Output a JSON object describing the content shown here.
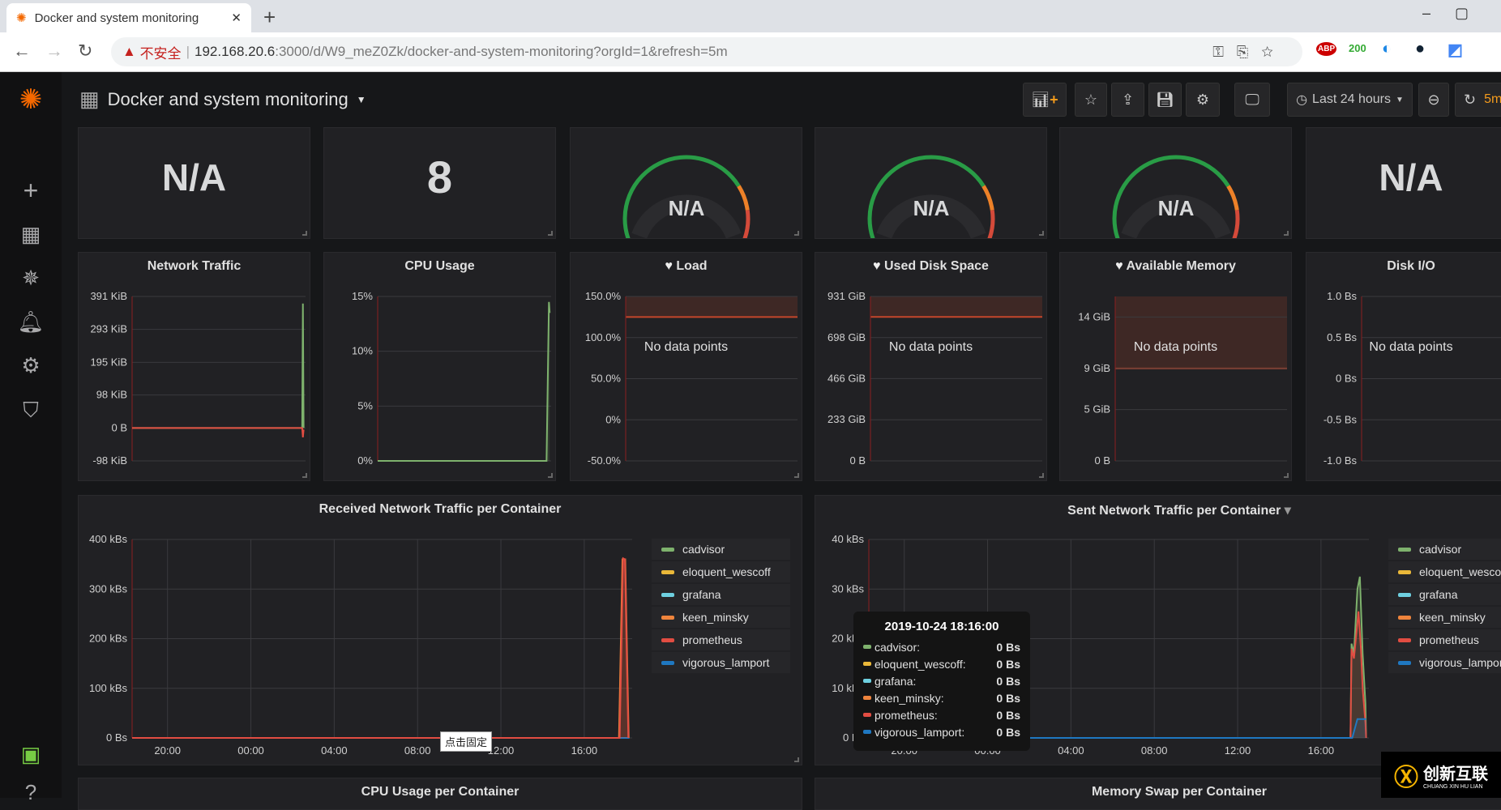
{
  "browser": {
    "tab_title": "Docker and system monitoring",
    "new_tab": "+",
    "insecure": "不安全",
    "url_host": "192.168.20.6",
    "url_rest": ":3000/d/W9_meZ0Zk/docker-and-system-monitoring?orgId=1&refresh=5m",
    "ext_abp": "ABP",
    "ext_count": "200"
  },
  "header": {
    "title": "Docker and system monitoring",
    "time_range": "Last 24 hours",
    "refresh": "5m"
  },
  "time_axis": {
    "start": "2019-10-23T18:18:00",
    "end": "2019-10-24T18:18:00",
    "ticks": [
      "20:00",
      "00:00",
      "04:00",
      "08:00",
      "12:00",
      "16:00"
    ]
  },
  "stats": [
    {
      "value": "N/A",
      "type": "singlestat"
    },
    {
      "value": "8",
      "type": "singlestat"
    },
    {
      "value": "N/A",
      "type": "gauge"
    },
    {
      "value": "N/A",
      "type": "gauge"
    },
    {
      "value": "N/A",
      "type": "gauge"
    },
    {
      "value": "N/A",
      "type": "singlestat"
    }
  ],
  "colors": {
    "cadvisor": "#7eb26d",
    "eloquent_wescoff": "#eab839",
    "grafana": "#6ed0e0",
    "keen_minsky": "#ef843c",
    "prometheus": "#e24d42",
    "vigorous_lamport": "#1f78c1",
    "threshold": "#c4462b",
    "gauge_green": "#299c46",
    "gauge_orange": "#ed8128",
    "gauge_red": "#d44a3a"
  },
  "small_graphs": [
    {
      "title": "Network Traffic",
      "heart": false,
      "nodata": "",
      "yticks": [
        [
          "391 KiB",
          391
        ],
        [
          "293 KiB",
          293
        ],
        [
          "195 KiB",
          195
        ],
        [
          "98 KiB",
          98
        ],
        [
          "0 B",
          0
        ],
        [
          "-98 KiB",
          -98
        ]
      ],
      "ymin": -98,
      "ymax": 391,
      "series": [
        {
          "color": "#7eb26d",
          "points": [
            [
              "2019-10-23T18:18",
              0
            ],
            [
              "2019-10-24T17:50",
              0
            ],
            [
              "2019-10-24T17:56",
              370
            ],
            [
              "2019-10-24T18:02",
              0
            ]
          ]
        },
        {
          "color": "#e24d42",
          "points": [
            [
              "2019-10-23T18:18",
              0
            ],
            [
              "2019-10-24T17:50",
              0
            ],
            [
              "2019-10-24T17:56",
              -28
            ],
            [
              "2019-10-24T18:02",
              -5
            ]
          ]
        }
      ]
    },
    {
      "title": "CPU Usage",
      "heart": false,
      "nodata": "",
      "yticks": [
        [
          "15%",
          15
        ],
        [
          "10%",
          10
        ],
        [
          "5%",
          5
        ],
        [
          "0%",
          0
        ]
      ],
      "ymin": 0,
      "ymax": 15,
      "series": [
        {
          "color": "#7eb26d",
          "points": [
            [
              "2019-10-23T18:18",
              0
            ],
            [
              "2019-10-24T17:40",
              0
            ],
            [
              "2019-10-24T18:00",
              14.5
            ],
            [
              "2019-10-24T18:06",
              13.5
            ]
          ]
        }
      ]
    },
    {
      "title": "Load",
      "heart": true,
      "nodata": "No data points",
      "yticks": [
        [
          "150.0%",
          150
        ],
        [
          "100.0%",
          100
        ],
        [
          "50.0%",
          50
        ],
        [
          "0%",
          0
        ],
        [
          "-50.0%",
          -50
        ]
      ],
      "ymin": -50,
      "ymax": 150,
      "threshold": [
        125,
        150
      ]
    },
    {
      "title": "Used Disk Space",
      "heart": true,
      "nodata": "No data points",
      "yticks": [
        [
          "931 GiB",
          931
        ],
        [
          "698 GiB",
          698
        ],
        [
          "466 GiB",
          466
        ],
        [
          "233 GiB",
          233
        ],
        [
          "0 B",
          0
        ]
      ],
      "ymin": 0,
      "ymax": 931,
      "threshold": [
        815,
        931
      ]
    },
    {
      "title": "Available Memory",
      "heart": true,
      "nodata": "No data points",
      "yticks": [
        [
          "14 GiB",
          14
        ],
        [
          "9 GiB",
          9
        ],
        [
          "5 GiB",
          5
        ],
        [
          "0 B",
          0
        ]
      ],
      "ymin": 0,
      "ymax": 16,
      "threshold": [
        9,
        16
      ]
    },
    {
      "title": "Disk I/O",
      "heart": false,
      "nodata": "No data points",
      "yticks": [
        [
          "1.0 Bs",
          1
        ],
        [
          "0.5 Bs",
          0.5
        ],
        [
          "0 Bs",
          0
        ],
        [
          "-0.5 Bs",
          -0.5
        ],
        [
          "-1.0 Bs",
          -1
        ]
      ],
      "ymin": -1,
      "ymax": 1
    }
  ],
  "big_graphs": [
    {
      "title": "Received Network Traffic per Container",
      "yticks": [
        [
          "400 kBs",
          400
        ],
        [
          "300 kBs",
          300
        ],
        [
          "200 kBs",
          200
        ],
        [
          "100 kBs",
          100
        ],
        [
          "0 Bs",
          0
        ]
      ],
      "ymin": 0,
      "ymax": 400,
      "series": [
        {
          "color": "#1f78c1",
          "points": [
            [
              "2019-10-23T18:18",
              0
            ],
            [
              "2019-10-24T18:10",
              0
            ]
          ]
        },
        {
          "color": "#ef843c",
          "points": [
            [
              "2019-10-23T18:18",
              0
            ],
            [
              "2019-10-24T17:40",
              0
            ],
            [
              "2019-10-24T17:50",
              360
            ],
            [
              "2019-10-24T17:58",
              360
            ],
            [
              "2019-10-24T18:08",
              0
            ]
          ]
        },
        {
          "color": "#e24d42",
          "points": [
            [
              "2019-10-23T18:18",
              0
            ],
            [
              "2019-10-24T17:42",
              0
            ],
            [
              "2019-10-24T17:52",
              362
            ],
            [
              "2019-10-24T17:57",
              360
            ],
            [
              "2019-10-24T18:07",
              0
            ]
          ]
        }
      ]
    },
    {
      "title": "Sent Network Traffic per Container",
      "yticks": [
        [
          "40 kBs",
          40
        ],
        [
          "30 kBs",
          30
        ],
        [
          "20 kBs",
          20
        ],
        [
          "10 kBs",
          10
        ],
        [
          "0 Bs",
          0
        ]
      ],
      "ymin": 0,
      "ymax": 40,
      "series": [
        {
          "color": "#7eb26d",
          "points": [
            [
              "2019-10-23T18:18",
              0
            ],
            [
              "2019-10-24T17:25",
              0
            ],
            [
              "2019-10-24T17:28",
              19
            ],
            [
              "2019-10-24T17:35",
              17
            ],
            [
              "2019-10-24T17:45",
              30
            ],
            [
              "2019-10-24T17:52",
              32.5
            ],
            [
              "2019-10-24T18:00",
              17
            ],
            [
              "2019-10-24T18:08",
              7
            ],
            [
              "2019-10-24T18:10",
              0
            ]
          ]
        },
        {
          "color": "#e24d42",
          "points": [
            [
              "2019-10-23T18:18",
              0
            ],
            [
              "2019-10-24T17:25",
              0
            ],
            [
              "2019-10-24T17:28",
              18
            ],
            [
              "2019-10-24T17:35",
              16
            ],
            [
              "2019-10-24T17:48",
              25.5
            ],
            [
              "2019-10-24T17:55",
              18
            ],
            [
              "2019-10-24T18:00",
              10
            ],
            [
              "2019-10-24T18:08",
              3
            ],
            [
              "2019-10-24T18:10",
              0
            ]
          ]
        },
        {
          "color": "#1f78c1",
          "points": [
            [
              "2019-10-23T18:18",
              0
            ],
            [
              "2019-10-24T17:30",
              0
            ],
            [
              "2019-10-24T17:45",
              3.8
            ],
            [
              "2019-10-24T18:10",
              3.8
            ]
          ]
        }
      ]
    }
  ],
  "legend": [
    {
      "name": "cadvisor",
      "color": "#7eb26d"
    },
    {
      "name": "eloquent_wescoff",
      "color": "#eab839"
    },
    {
      "name": "grafana",
      "color": "#6ed0e0"
    },
    {
      "name": "keen_minsky",
      "color": "#ef843c"
    },
    {
      "name": "prometheus",
      "color": "#e24d42"
    },
    {
      "name": "vigorous_lamport",
      "color": "#1f78c1"
    }
  ],
  "tooltip": {
    "time": "2019-10-24 18:16:00",
    "rows": [
      {
        "name": "cadvisor:",
        "value": "0 Bs",
        "color": "#7eb26d"
      },
      {
        "name": "eloquent_wescoff:",
        "value": "0 Bs",
        "color": "#eab839"
      },
      {
        "name": "grafana:",
        "value": "0 Bs",
        "color": "#6ed0e0"
      },
      {
        "name": "keen_minsky:",
        "value": "0 Bs",
        "color": "#ef843c"
      },
      {
        "name": "prometheus:",
        "value": "0 Bs",
        "color": "#e24d42"
      },
      {
        "name": "vigorous_lamport:",
        "value": "0 Bs",
        "color": "#1f78c1"
      }
    ]
  },
  "pin_hint": "点击固定",
  "bottom_panels": [
    "CPU Usage per Container",
    "Memory Swap per Container"
  ],
  "watermark": {
    "name": "创新互联",
    "sub": "CHUANG XIN HU LIAN"
  }
}
